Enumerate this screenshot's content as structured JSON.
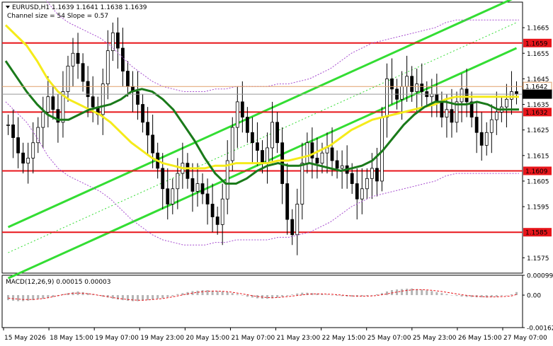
{
  "chart_data": {
    "type": "candlestick",
    "title": "EURUSD,H1  1.1639 1.1641 1.1638 1.1639",
    "channel_text": "Channel size = 54 Slope = 0.57",
    "colors": {
      "candle": "#000000",
      "ma_fast": "#1a7a1a",
      "ma_slow": "#f5eb1b",
      "channel": "#33dd33",
      "bollinger": "#a64ccf",
      "level": "#e8161b",
      "level_label_bg": "#e8161b",
      "price_label_bg": "#000000",
      "macd_hist": "#b4b4b4",
      "macd_signal": "#e8161b"
    },
    "price_axis": {
      "range": [
        1.1569,
        1.1675
      ],
      "ticks": [
        "1.1665",
        "1.1655",
        "1.1645",
        "1.1635",
        "1.1625",
        "1.1615",
        "1.1605",
        "1.1595",
        "1.1575"
      ]
    },
    "levels": [
      {
        "value": 1.1659,
        "label": "1.1659"
      },
      {
        "value": 1.1632,
        "label": "1.1632"
      },
      {
        "value": 1.1609,
        "label": "1.1609"
      },
      {
        "value": 1.1585,
        "label": "1.1585"
      }
    ],
    "price_labels": [
      {
        "value": 1.1642,
        "label": "1.1642",
        "kind": "ask"
      },
      {
        "value": 1.1639,
        "label": "1.1639",
        "kind": "bid"
      }
    ],
    "time_axis": {
      "labels": [
        "15 May 2026",
        "18 May 15:00",
        "19 May 07:00",
        "19 May 23:00",
        "20 May 15:00",
        "21 May 07:00",
        "21 May 23:00",
        "22 May 15:00",
        "25 May 07:00",
        "25 May 23:00",
        "26 May 15:00",
        "27 May 07:00"
      ]
    },
    "closes": [
      1.1627,
      1.1622,
      1.1616,
      1.1612,
      1.1614,
      1.162,
      1.1626,
      1.1632,
      1.1638,
      1.1633,
      1.1628,
      1.164,
      1.165,
      1.1655,
      1.1651,
      1.1644,
      1.1638,
      1.1634,
      1.1631,
      1.1643,
      1.1656,
      1.1663,
      1.1657,
      1.1648,
      1.1642,
      1.164,
      1.1635,
      1.1628,
      1.1623,
      1.1616,
      1.161,
      1.1602,
      1.1596,
      1.1602,
      1.1608,
      1.1612,
      1.1606,
      1.1601,
      1.1604,
      1.16,
      1.1596,
      1.1591,
      1.1588,
      1.1598,
      1.1613,
      1.1626,
      1.1636,
      1.163,
      1.1624,
      1.162,
      1.1617,
      1.1612,
      1.1618,
      1.1628,
      1.162,
      1.1604,
      1.159,
      1.1584,
      1.1596,
      1.1612,
      1.162,
      1.1614,
      1.1612,
      1.1616,
      1.1618,
      1.1613,
      1.161,
      1.1611,
      1.1608,
      1.1604,
      1.1598,
      1.1602,
      1.1606,
      1.161,
      1.1605,
      1.163,
      1.1645,
      1.1641,
      1.1637,
      1.1642,
      1.1646,
      1.164,
      1.1643,
      1.164,
      1.1638,
      1.1639,
      1.1636,
      1.163,
      1.1633,
      1.1628,
      1.1636,
      1.1641,
      1.1636,
      1.163,
      1.1624,
      1.1619,
      1.1624,
      1.1629,
      1.1632,
      1.1634,
      1.1637,
      1.164,
      1.1639
    ],
    "moving_averages": [
      {
        "values": [
          1.1652,
          1.1646,
          1.164,
          1.1635,
          1.1631,
          1.1629,
          1.1629,
          1.1631,
          1.1633,
          1.1634,
          1.1635,
          1.1637,
          1.164,
          1.1641,
          1.164,
          1.1637,
          1.1633,
          1.1627,
          1.1621,
          1.1614,
          1.1608,
          1.1604,
          1.1604,
          1.1606,
          1.1609,
          1.1611,
          1.1612,
          1.1611,
          1.1611,
          1.1612,
          1.1611,
          1.161,
          1.1609,
          1.161,
          1.1611,
          1.1613,
          1.1617,
          1.1622,
          1.1627,
          1.1631,
          1.1634,
          1.1636,
          1.1636,
          1.1635,
          1.1635,
          1.1636,
          1.1635,
          1.1633,
          1.1633,
          1.1633
        ]
      },
      {
        "values": [
          1.1666,
          1.1662,
          1.1658,
          1.1652,
          1.1645,
          1.164,
          1.1637,
          1.1635,
          1.1633,
          1.1631,
          1.1628,
          1.1624,
          1.162,
          1.1617,
          1.1614,
          1.1612,
          1.1611,
          1.161,
          1.161,
          1.161,
          1.1611,
          1.1611,
          1.1612,
          1.1612,
          1.1612,
          1.1612,
          1.1613,
          1.1613,
          1.1614,
          1.1615,
          1.1617,
          1.1619,
          1.1622,
          1.1625,
          1.1627,
          1.1629,
          1.163,
          1.1631,
          1.1632,
          1.1633,
          1.1634,
          1.1635,
          1.1637,
          1.1638,
          1.1638,
          1.1638,
          1.1638,
          1.1638,
          1.1638,
          1.1638
        ]
      }
    ],
    "channel_lines": [
      {
        "from": [
          0,
          1.1587
        ],
        "to": [
          102,
          1.1677
        ]
      },
      {
        "from": [
          0,
          1.1567
        ],
        "to": [
          102,
          1.1657
        ]
      },
      {
        "from": [
          0,
          1.1577
        ],
        "to": [
          102,
          1.1667
        ]
      }
    ],
    "macd": {
      "title": "MACD(12,26,9) 0.00015 0.00003",
      "ticks": [
        "0.00099",
        "0.00",
        "-0.00162"
      ],
      "range": [
        -0.00162,
        0.00099
      ],
      "histogram": [
        -0.00025,
        -0.00028,
        -0.0003,
        -0.0003,
        -0.00028,
        -0.00025,
        -0.0002,
        -0.00018,
        -0.00015,
        -0.0001,
        -5e-05,
        5e-05,
        0.0001,
        0.00015,
        0.00018,
        0.00015,
        0.0001,
        5e-05,
        -2e-05,
        -8e-05,
        -0.00012,
        -0.00018,
        -0.00022,
        -0.00025,
        -0.00028,
        -0.0003,
        -0.0003,
        -0.00028,
        -0.00025,
        -0.00022,
        -0.00018,
        -0.00015,
        -0.0001,
        -5e-05,
        5e-05,
        0.0001,
        0.00015,
        0.0002,
        0.00022,
        0.00025,
        0.00025,
        0.00022,
        0.0002,
        0.00018,
        0.00015,
        0.0001,
        5e-05,
        -2e-05,
        -8e-05,
        -0.00012,
        -0.00016,
        -0.00018,
        -0.00018,
        -0.00016,
        -0.00012,
        -8e-05,
        -4e-05,
        3e-05,
        8e-05,
        0.00012,
        0.00012,
        0.0001,
        8e-05,
        5e-05,
        2e-05,
        -1e-05,
        -3e-05,
        -5e-05,
        -7e-05,
        -8e-05,
        -8e-05,
        -6e-05,
        -4e-05,
        -2e-05,
        4e-05,
        0.0001,
        0.00018,
        0.00025,
        0.00028,
        0.0003,
        0.00032,
        0.00033,
        0.0003,
        0.00027,
        0.00024,
        0.0002,
        0.00015,
        0.0001,
        5e-05,
        0.0,
        -4e-05,
        -7e-05,
        -9e-05,
        -0.0001,
        -0.00011,
        -0.00011,
        -0.00012,
        -0.0001,
        -8e-05,
        -4e-05,
        0.0,
        4e-05,
        0.00015
      ],
      "signal": [
        -0.00015,
        -0.00018,
        -0.0002,
        -0.00022,
        -0.00022,
        -0.00022,
        -0.0002,
        -0.00017,
        -0.00013,
        -8e-05,
        -3e-05,
        2e-05,
        6e-05,
        9e-05,
        0.0001,
        9e-05,
        7e-05,
        4e-05,
        0.0,
        -4e-05,
        -8e-05,
        -0.00012,
        -0.00016,
        -0.00019,
        -0.00022,
        -0.00024,
        -0.00025,
        -0.00025,
        -0.00024,
        -0.00022,
        -0.0002,
        -0.00017,
        -0.00013,
        -9e-05,
        -4e-05,
        1e-05,
        6e-05,
        0.0001,
        0.00014,
        0.00017,
        0.00019,
        0.0002,
        0.0002,
        0.00019,
        0.00017,
        0.00014,
        0.0001,
        6e-05,
        2e-05,
        -3e-05,
        -7e-05,
        -0.0001,
        -0.00012,
        -0.00013,
        -0.00012,
        -0.0001,
        -8e-05,
        -5e-05,
        -2e-05,
        1e-05,
        4e-05,
        6e-05,
        6e-05,
        6e-05,
        5e-05,
        4e-05,
        2e-05,
        0.0,
        -2e-05,
        -4e-05,
        -5e-05,
        -5e-05,
        -5e-05,
        -4e-05,
        -2e-05,
        2e-05,
        6e-05,
        0.00011,
        0.00015,
        0.0002,
        0.00023,
        0.00026,
        0.00027,
        0.00027,
        0.00026,
        0.00024,
        0.00021,
        0.00018,
        0.00014,
        0.0001,
        6e-05,
        2e-05,
        -1e-05,
        -4e-05,
        -6e-05,
        -8e-05,
        -9e-05,
        -9e-05,
        -9e-05,
        -8e-05,
        -6e-05,
        -4e-05,
        3e-05
      ]
    }
  }
}
